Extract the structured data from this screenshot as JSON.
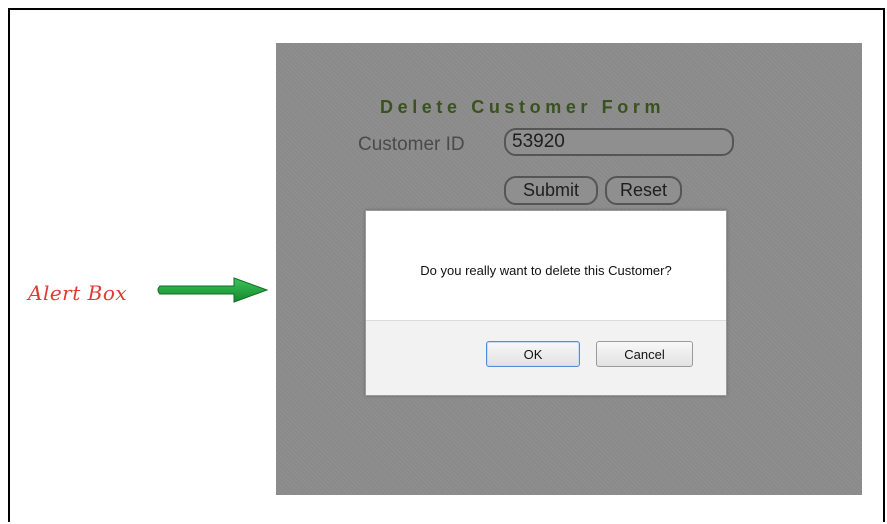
{
  "annotation": {
    "label": "Alert Box",
    "arrow_icon": "right-arrow-icon",
    "label_color": "#e03a33",
    "arrow_color": "#1fa33b"
  },
  "form": {
    "title": "Delete Customer Form",
    "field_label": "Customer ID",
    "customer_id_value": "53920",
    "submit_label": "Submit",
    "reset_label": "Reset",
    "title_color": "#3a5120",
    "panel_color": "#8a8a8a"
  },
  "dialog": {
    "message": "Do you really want to delete this Customer?",
    "ok_label": "OK",
    "cancel_label": "Cancel",
    "ok_focus_color": "#4f8ed8"
  }
}
